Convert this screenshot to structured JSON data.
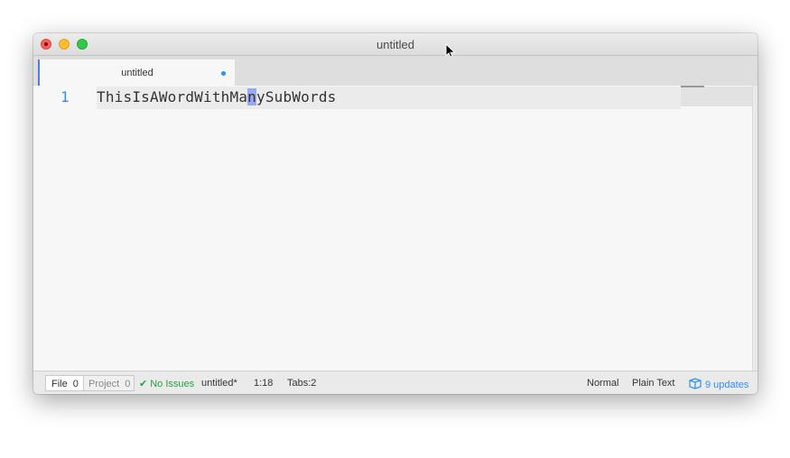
{
  "window": {
    "title": "untitled"
  },
  "tab": {
    "label": "untitled"
  },
  "editor": {
    "line_number": "1",
    "code_before": "ThisIsAWordWithMa",
    "code_selected": "n",
    "code_after": "ySubWords"
  },
  "status": {
    "file_label": "File",
    "file_count": "0",
    "project_label": "Project",
    "project_count": "0",
    "issues": "No Issues",
    "filename": "untitled*",
    "cursor_position": "1:18",
    "tabs": "Tabs:2",
    "mode": "Normal",
    "grammar": "Plain Text",
    "updates": "9 updates"
  },
  "colors": {
    "accent": "#2f8ef5",
    "selection": "#9aa8ef",
    "success": "#23a33c"
  }
}
